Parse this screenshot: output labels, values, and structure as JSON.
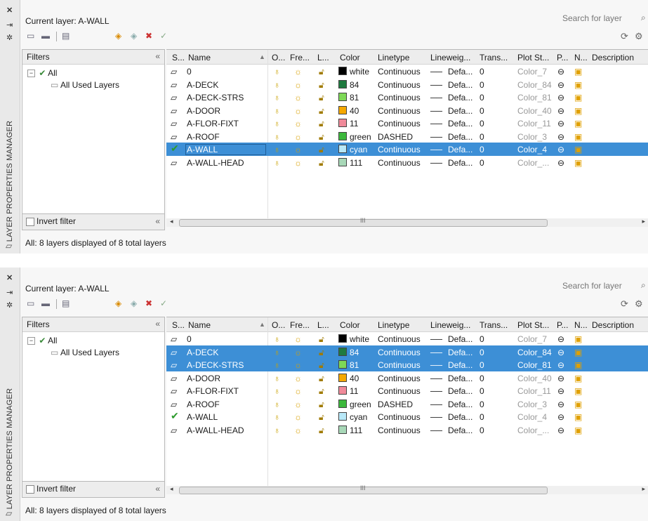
{
  "panels": [
    {
      "title": "LAYER PROPERTIES MANAGER",
      "current_layer": "Current layer: A-WALL",
      "search_placeholder": "Search for layer",
      "filters_header": "Filters",
      "filter_tree": [
        "All",
        "All Used Layers"
      ],
      "invert_filter": "Invert filter",
      "status": "All: 8 layers displayed of 8 total layers",
      "columns": [
        "S...",
        "Name",
        "O...",
        "Fre...",
        "L...",
        "Color",
        "Linetype",
        "Lineweig...",
        "Trans...",
        "Plot St...",
        "P...",
        "N...",
        "Description"
      ],
      "rows": [
        {
          "name": "0",
          "color_name": "white",
          "color_hex": "#000000",
          "linetype": "Continuous",
          "lineweight": "Defa...",
          "transparency": "0",
          "plot_style": "Color_7",
          "current": false,
          "selected": false
        },
        {
          "name": "A-DECK",
          "color_name": "84",
          "color_hex": "#1f7a3f",
          "linetype": "Continuous",
          "lineweight": "Defa...",
          "transparency": "0",
          "plot_style": "Color_84",
          "current": false,
          "selected": false
        },
        {
          "name": "A-DECK-STRS",
          "color_name": "81",
          "color_hex": "#7ed957",
          "linetype": "Continuous",
          "lineweight": "Defa...",
          "transparency": "0",
          "plot_style": "Color_81",
          "current": false,
          "selected": false
        },
        {
          "name": "A-DOOR",
          "color_name": "40",
          "color_hex": "#f5a800",
          "linetype": "Continuous",
          "lineweight": "Defa...",
          "transparency": "0",
          "plot_style": "Color_40",
          "current": false,
          "selected": false
        },
        {
          "name": "A-FLOR-FIXT",
          "color_name": "11",
          "color_hex": "#f08a9a",
          "linetype": "Continuous",
          "lineweight": "Defa...",
          "transparency": "0",
          "plot_style": "Color_11",
          "current": false,
          "selected": false
        },
        {
          "name": "A-ROOF",
          "color_name": "green",
          "color_hex": "#3cb83c",
          "linetype": "DASHED",
          "lineweight": "Defa...",
          "transparency": "0",
          "plot_style": "Color_3",
          "current": false,
          "selected": false,
          "frozen_style": true
        },
        {
          "name": "A-WALL",
          "color_name": "cyan",
          "color_hex": "#b8e8f8",
          "linetype": "Continuous",
          "lineweight": "Defa...",
          "transparency": "0",
          "plot_style": "Color_4",
          "current": true,
          "selected": true
        },
        {
          "name": "A-WALL-HEAD",
          "color_name": "111",
          "color_hex": "#a8d8b8",
          "linetype": "Continuous",
          "lineweight": "Defa...",
          "transparency": "0",
          "plot_style": "Color_...",
          "current": false,
          "selected": false,
          "frozen_style": true
        }
      ]
    },
    {
      "title": "LAYER PROPERTIES MANAGER",
      "current_layer": "Current layer: A-WALL",
      "search_placeholder": "Search for layer",
      "filters_header": "Filters",
      "filter_tree": [
        "All",
        "All Used Layers"
      ],
      "invert_filter": "Invert filter",
      "status": "All: 8 layers displayed of 8 total layers",
      "columns": [
        "S...",
        "Name",
        "O...",
        "Fre...",
        "L...",
        "Color",
        "Linetype",
        "Lineweig...",
        "Trans...",
        "Plot St...",
        "P...",
        "N...",
        "Description"
      ],
      "rows": [
        {
          "name": "0",
          "color_name": "white",
          "color_hex": "#000000",
          "linetype": "Continuous",
          "lineweight": "Defa...",
          "transparency": "0",
          "plot_style": "Color_7",
          "current": false,
          "selected": false
        },
        {
          "name": "A-DECK",
          "color_name": "84",
          "color_hex": "#1f7a3f",
          "linetype": "Continuous",
          "lineweight": "Defa...",
          "transparency": "0",
          "plot_style": "Color_84",
          "current": false,
          "selected": true
        },
        {
          "name": "A-DECK-STRS",
          "color_name": "81",
          "color_hex": "#7ed957",
          "linetype": "Continuous",
          "lineweight": "Defa...",
          "transparency": "0",
          "plot_style": "Color_81",
          "current": false,
          "selected": true
        },
        {
          "name": "A-DOOR",
          "color_name": "40",
          "color_hex": "#f5a800",
          "linetype": "Continuous",
          "lineweight": "Defa...",
          "transparency": "0",
          "plot_style": "Color_40",
          "current": false,
          "selected": false
        },
        {
          "name": "A-FLOR-FIXT",
          "color_name": "11",
          "color_hex": "#f08a9a",
          "linetype": "Continuous",
          "lineweight": "Defa...",
          "transparency": "0",
          "plot_style": "Color_11",
          "current": false,
          "selected": false
        },
        {
          "name": "A-ROOF",
          "color_name": "green",
          "color_hex": "#3cb83c",
          "linetype": "DASHED",
          "lineweight": "Defa...",
          "transparency": "0",
          "plot_style": "Color_3",
          "current": false,
          "selected": false,
          "frozen_style": true
        },
        {
          "name": "A-WALL",
          "color_name": "cyan",
          "color_hex": "#b8e8f8",
          "linetype": "Continuous",
          "lineweight": "Defa...",
          "transparency": "0",
          "plot_style": "Color_4",
          "current": true,
          "selected": false
        },
        {
          "name": "A-WALL-HEAD",
          "color_name": "111",
          "color_hex": "#a8d8b8",
          "linetype": "Continuous",
          "lineweight": "Defa...",
          "transparency": "0",
          "plot_style": "Color_...",
          "current": false,
          "selected": false,
          "frozen_style": true
        }
      ]
    }
  ],
  "icons": {
    "close": "close-icon",
    "dock": "dock-icon",
    "settings": "settings-icon",
    "refresh": "refresh-icon",
    "bulb": "bulb-icon",
    "sun": "sun-icon",
    "lock": "lock-icon",
    "printer": "printer-icon",
    "new_vp": "new-viewport-freeze-icon",
    "current_check": "checkmark-icon",
    "layer_parallelogram": "layer-icon"
  },
  "selection_color": "#3d8fd6"
}
